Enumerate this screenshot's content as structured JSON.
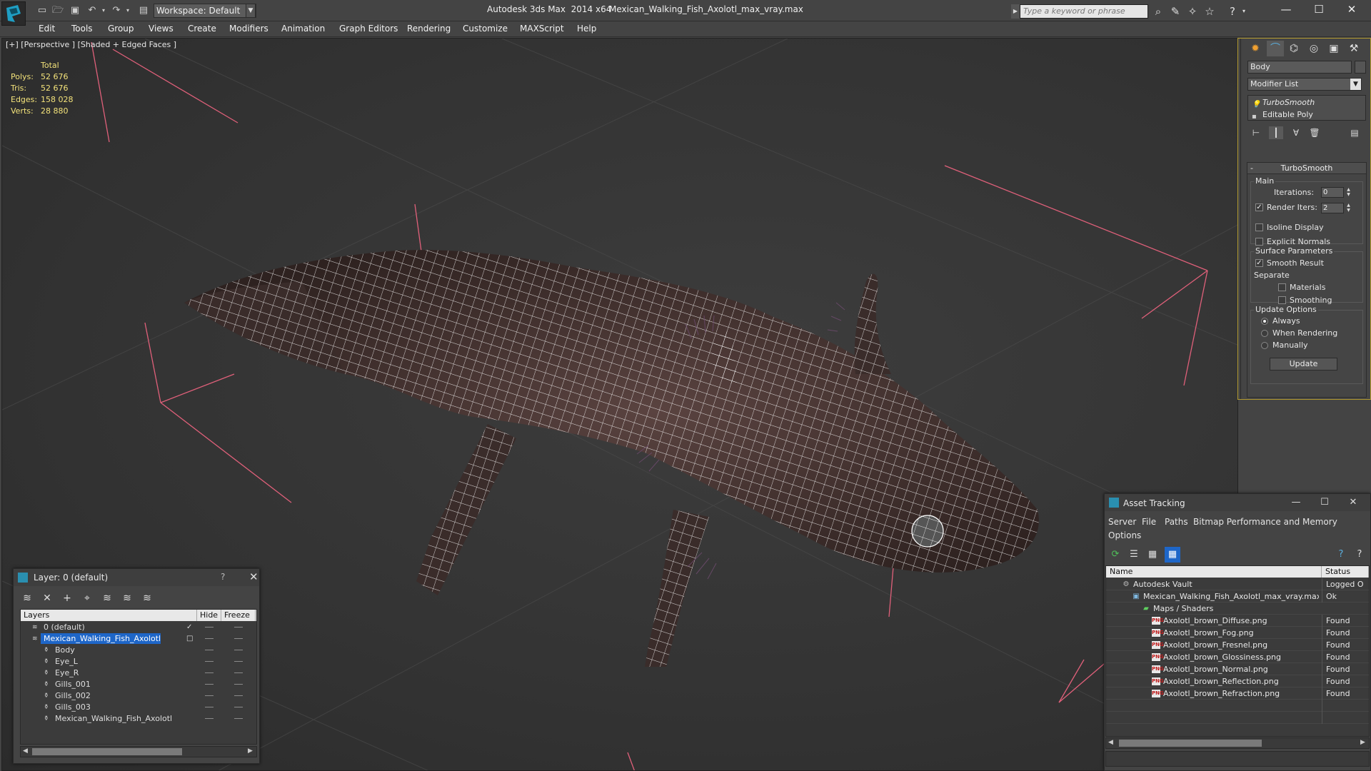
{
  "title_bar": {
    "workspace": "Workspace: Default",
    "app_title": "Autodesk 3ds Max  2014 x64",
    "file_name": "Mexican_Walking_Fish_Axolotl_max_vray.max",
    "search_placeholder": "Type a keyword or phrase"
  },
  "menu": [
    "Edit",
    "Tools",
    "Group",
    "Views",
    "Create",
    "Modifiers",
    "Animation",
    "Graph Editors",
    "Rendering",
    "Customize",
    "MAXScript",
    "Help"
  ],
  "viewport": {
    "label": "[+] [Perspective ] [Shaded + Edged Faces ]",
    "stats_total_label": "Total",
    "stats": [
      {
        "key": "Polys:",
        "value": "52 676"
      },
      {
        "key": "Tris:",
        "value": "52 676"
      },
      {
        "key": "Edges:",
        "value": "158 028"
      },
      {
        "key": "Verts:",
        "value": "28 880"
      }
    ]
  },
  "command_panel": {
    "object_name": "Body",
    "modifier_list": "Modifier List",
    "stack": [
      {
        "label": "TurboSmooth",
        "italic": true
      },
      {
        "label": "Editable Poly",
        "italic": false
      }
    ],
    "rollout_title": "TurboSmooth",
    "main_group": "Main",
    "iterations_label": "Iterations:",
    "iterations_value": "0",
    "render_iters_label": "Render Iters:",
    "render_iters_value": "2",
    "render_iters_checked": true,
    "isoline_label": "Isoline Display",
    "explicit_normals_label": "Explicit Normals",
    "surface_group": "Surface Parameters",
    "smooth_result_label": "Smooth Result",
    "separate_label": "Separate",
    "materials_label": "Materials",
    "smoothing_groups_label": "Smoothing Groups",
    "update_group": "Update Options",
    "always_label": "Always",
    "when_rendering_label": "When Rendering",
    "manually_label": "Manually",
    "update_button": "Update"
  },
  "layer_window": {
    "title": "Layer: 0 (default)",
    "help": "?",
    "columns": [
      "Layers",
      "Hide",
      "Freeze"
    ],
    "rows": [
      {
        "name": "0 (default)",
        "level": 0,
        "selected": false,
        "active": true
      },
      {
        "name": "Mexican_Walking_Fish_Axolotl",
        "level": 0,
        "selected": true,
        "active": false
      },
      {
        "name": "Body",
        "level": 1,
        "selected": false,
        "active": false
      },
      {
        "name": "Eye_L",
        "level": 1,
        "selected": false,
        "active": false
      },
      {
        "name": "Eye_R",
        "level": 1,
        "selected": false,
        "active": false
      },
      {
        "name": "Gills_001",
        "level": 1,
        "selected": false,
        "active": false
      },
      {
        "name": "Gills_002",
        "level": 1,
        "selected": false,
        "active": false
      },
      {
        "name": "Gills_003",
        "level": 1,
        "selected": false,
        "active": false
      },
      {
        "name": "Mexican_Walking_Fish_Axolotl",
        "level": 1,
        "selected": false,
        "active": false
      }
    ]
  },
  "asset_window": {
    "title": "Asset Tracking",
    "menu": [
      "Server",
      "File",
      "Paths",
      "Bitmap Performance and Memory",
      "Options"
    ],
    "columns": [
      "Name",
      "Status"
    ],
    "rows": [
      {
        "name": "Autodesk Vault",
        "status": "Logged O",
        "level": 0,
        "icon": "vault"
      },
      {
        "name": "Mexican_Walking_Fish_Axolotl_max_vray.max",
        "status": "Ok",
        "level": 1,
        "icon": "max"
      },
      {
        "name": "Maps / Shaders",
        "status": "",
        "level": 2,
        "icon": "maps"
      },
      {
        "name": "Axolotl_brown_Diffuse.png",
        "status": "Found",
        "level": 3,
        "icon": "png"
      },
      {
        "name": "Axolotl_brown_Fog.png",
        "status": "Found",
        "level": 3,
        "icon": "png"
      },
      {
        "name": "Axolotl_brown_Fresnel.png",
        "status": "Found",
        "level": 3,
        "icon": "png"
      },
      {
        "name": "Axolotl_brown_Glossiness.png",
        "status": "Found",
        "level": 3,
        "icon": "png"
      },
      {
        "name": "Axolotl_brown_Normal.png",
        "status": "Found",
        "level": 3,
        "icon": "png"
      },
      {
        "name": "Axolotl_brown_Reflection.png",
        "status": "Found",
        "level": 3,
        "icon": "png"
      },
      {
        "name": "Axolotl_brown_Refraction.png",
        "status": "Found",
        "level": 3,
        "icon": "png"
      }
    ],
    "png_badge": "PNG"
  },
  "colors": {
    "ui_bg": "#444444",
    "accent_selection": "#1e66c8",
    "stats_text": "#f3e27a",
    "wire": "#ffffff",
    "grid_pink": "#e0607a",
    "panel_outline": "#b29a30"
  },
  "icons": {
    "logo": "3dsmax-logo",
    "close": "✕",
    "maximize": "☐",
    "minimize": "—"
  }
}
